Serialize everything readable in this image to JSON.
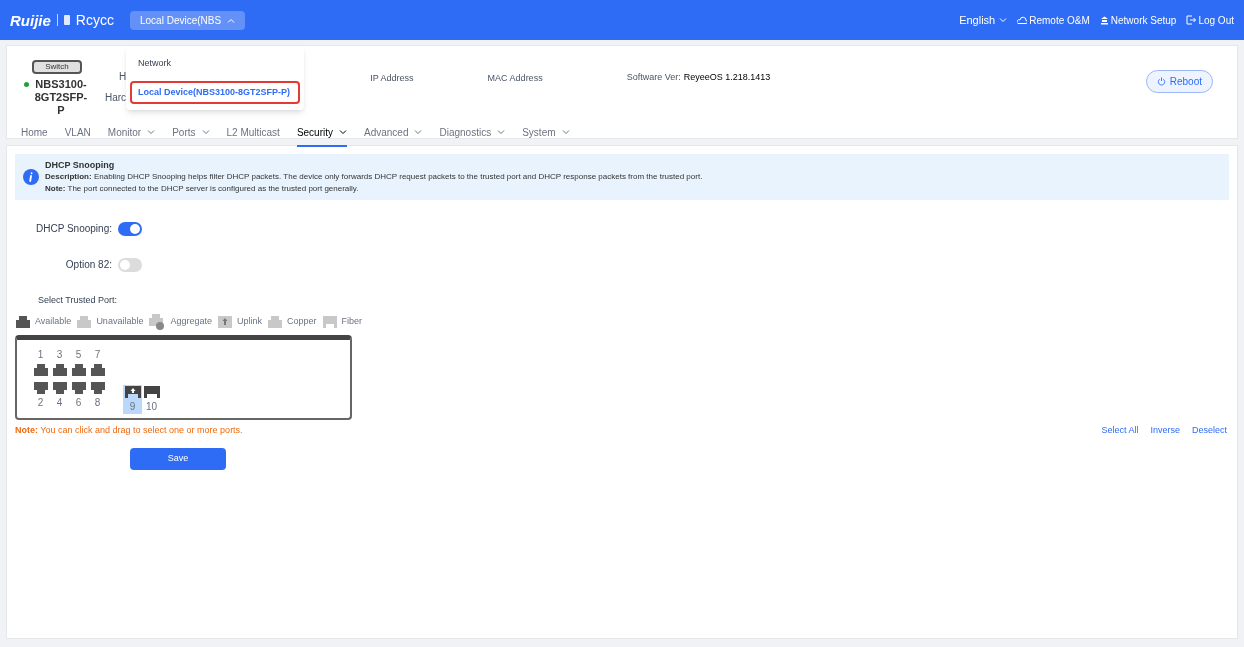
{
  "topbar": {
    "logo": "Ruijie",
    "brand": "Rcycc",
    "device_selector": "Local Device(NBS",
    "language": "English",
    "links": [
      {
        "kind": "remote",
        "label": "Remote O&M"
      },
      {
        "kind": "network",
        "label": "Network Setup"
      },
      {
        "kind": "logout",
        "label": "Log Out"
      }
    ]
  },
  "device_menu": {
    "items": [
      {
        "label": "Network",
        "selected": false
      },
      {
        "label": "Local Device(NBS3100-8GT2SFP-P)",
        "selected": true
      }
    ]
  },
  "device": {
    "badge": "Switch",
    "online": true,
    "model": "NBS3100-8GT2SFP-P",
    "hidden_labels": [
      "H",
      "Harc"
    ],
    "ip_label": "IP Address",
    "mac_label": "MAC Address",
    "software_label": "Software Ver:",
    "software_value": "ReyeeOS 1.218.1413",
    "reboot": "Reboot"
  },
  "nav": [
    {
      "label": "Home",
      "selected": false,
      "menu": false
    },
    {
      "label": "VLAN",
      "selected": false,
      "menu": false
    },
    {
      "label": "Monitor",
      "selected": false,
      "menu": true
    },
    {
      "label": "Ports",
      "selected": false,
      "menu": true
    },
    {
      "label": "L2 Multicast",
      "selected": false,
      "menu": false
    },
    {
      "label": "Security",
      "selected": true,
      "menu": true
    },
    {
      "label": "Advanced",
      "selected": false,
      "menu": true
    },
    {
      "label": "Diagnostics",
      "selected": false,
      "menu": true
    },
    {
      "label": "System",
      "selected": false,
      "menu": true
    }
  ],
  "info": {
    "title": "DHCP Snooping",
    "lines": [
      "**Description:** Enabling DHCP Snooping helps filter DHCP packets. The device only forwards DHCP request packets to the trusted port and DHCP response packets from the trusted port.",
      "**Note:** The port connected to the DHCP server is configured as the trusted port generally."
    ]
  },
  "settings": [
    {
      "label": "DHCP Snooping:",
      "on": true
    },
    {
      "label": "Option 82:",
      "on": false
    }
  ],
  "trusted_port": {
    "label": "Select Trusted Port:",
    "legend": [
      {
        "kind": "available",
        "label": "Available"
      },
      {
        "kind": "unavailable",
        "label": "Unavailable"
      },
      {
        "kind": "aggregate",
        "label": "Aggregate"
      },
      {
        "kind": "uplink",
        "label": "Uplink"
      },
      {
        "kind": "copper",
        "label": "Copper"
      },
      {
        "kind": "fiber",
        "label": "Fiber"
      }
    ],
    "ports_top": [
      {
        "label": "1",
        "selected": false,
        "uplink": false
      },
      {
        "label": "3",
        "selected": false,
        "uplink": false
      },
      {
        "label": "5",
        "selected": false,
        "uplink": false
      },
      {
        "label": "7",
        "selected": false,
        "uplink": false
      }
    ],
    "ports_bottom": [
      {
        "label": "2",
        "selected": false,
        "uplink": false
      },
      {
        "label": "4",
        "selected": false,
        "uplink": false
      },
      {
        "label": "6",
        "selected": false,
        "uplink": false
      },
      {
        "label": "8",
        "selected": false,
        "uplink": false
      }
    ],
    "sfp_ports": [
      {
        "label": "9",
        "selected": true,
        "uplink": true
      },
      {
        "label": "10",
        "selected": false,
        "uplink": false
      }
    ],
    "note_label": "Note:",
    "note": "You can click and drag to select one or more ports.",
    "actions": [
      "Select All",
      "Inverse",
      "Deselect"
    ],
    "save": "Save"
  }
}
